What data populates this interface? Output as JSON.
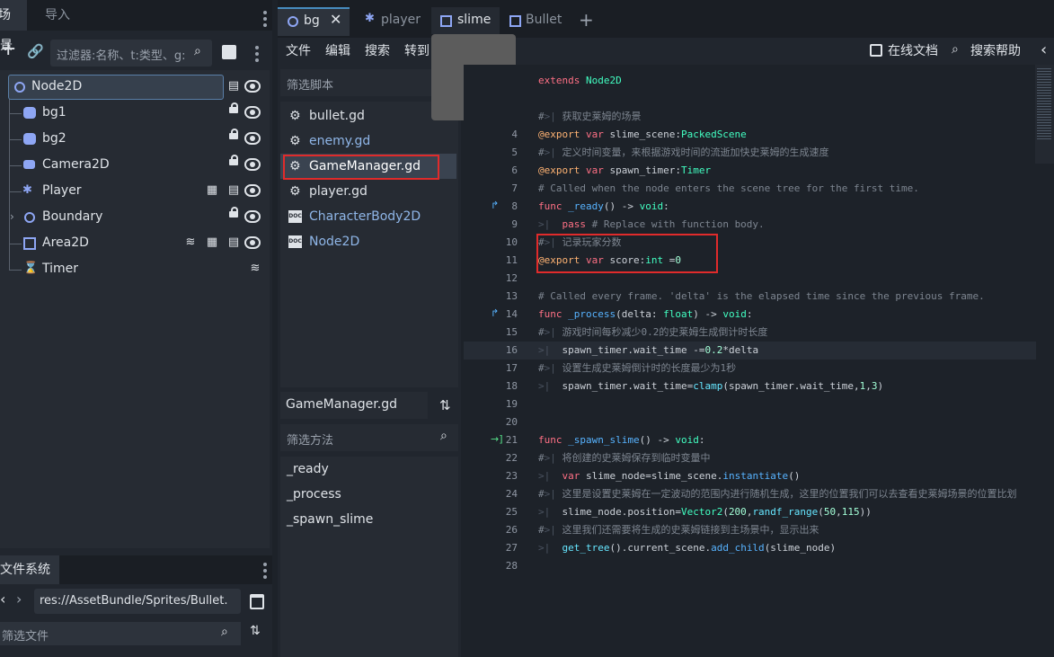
{
  "left_tabs": [
    "场景",
    "导入"
  ],
  "scene_filter_placeholder": "过滤器:名称、t:类型、g:",
  "scene_tree": [
    {
      "label": "Node2D",
      "icon": "node2d-circle-icon",
      "selected": true
    },
    {
      "label": "bg1",
      "icon": "sprite-icon"
    },
    {
      "label": "bg2",
      "icon": "sprite-icon"
    },
    {
      "label": "Camera2D",
      "icon": "camera-icon"
    },
    {
      "label": "Player",
      "icon": "character-icon"
    },
    {
      "label": "Boundary",
      "icon": "node2d-circle-icon"
    },
    {
      "label": "Area2D",
      "icon": "area-icon"
    },
    {
      "label": "Timer",
      "icon": "timer-icon"
    }
  ],
  "filesystem": {
    "tab": "文件系统",
    "path": "res://AssetBundle/Sprites/Bullet.",
    "filter_placeholder": "筛选文件"
  },
  "editor_tabs": [
    "bg",
    "player",
    "slime",
    "Bullet"
  ],
  "menu": [
    "文件",
    "编辑",
    "搜索",
    "转到"
  ],
  "right_links": {
    "docs": "在线文档",
    "help": "搜索帮助"
  },
  "scripts_filter": "筛选脚本",
  "scripts": [
    "bullet.gd",
    "enemy.gd",
    "GameManager.gd",
    "player.gd",
    "CharacterBody2D",
    "Node2D"
  ],
  "current_script": "GameManager.gd",
  "methods_filter": "筛选方法",
  "methods": [
    "_ready",
    "_process",
    "_spawn_slime"
  ],
  "line_numbers": [
    "",
    "",
    "",
    "4",
    "5",
    "6",
    "7",
    "8",
    "9",
    "10",
    "11",
    "12",
    "13",
    "14",
    "15",
    "16",
    "17",
    "18",
    "19",
    "20",
    "21",
    "22",
    "23",
    "24",
    "25",
    "26",
    "27",
    "28"
  ],
  "code_lines": [
    "extends Node2D",
    "",
    "#  获取史莱姆的场景",
    "@export var slime_scene:PackedScene",
    "#  定义时间变量，来根据游戏时间的流逝加快史莱姆的生成速度",
    "@export var spawn_timer:Timer",
    "# Called when the node enters the scene tree for the first time.",
    "func _ready() -> void:",
    "    pass # Replace with function body.",
    "#  记录玩家分数",
    "@export var score:int =0",
    "",
    "# Called every frame. 'delta' is the elapsed time since the previous frame.",
    "func _process(delta: float) -> void:",
    "#  游戏时间每秒减少0.2的史莱姆生成倒计时长度",
    "    spawn_timer.wait_time -=0.2*delta",
    "#  设置生成史莱姆倒计时的长度最少为1秒",
    "    spawn_timer.wait_time=clamp(spawn_timer.wait_time,1,3)",
    "",
    "",
    "func _spawn_slime() -> void:",
    "#  将创建的史莱姆保存到临时变量中",
    "    var slime_node=slime_scene.instantiate()",
    "#  这里是设置史莱姆在一定波动的范围内进行随机生成，这里的位置我们可以去查看史莱姆场景的位置比划",
    "    slime_node.position=Vector2(200,randf_range(50,115))",
    "#  这里我们还需要将生成的史莱姆链接到主场景中，显示出来",
    "    get_tree().current_scene.add_child(slime_node)",
    ""
  ],
  "colors": {
    "accent": "#478cbf",
    "highlight_box": "#e02b2b",
    "keyword": "#ff7085",
    "comment": "#7d8590"
  }
}
